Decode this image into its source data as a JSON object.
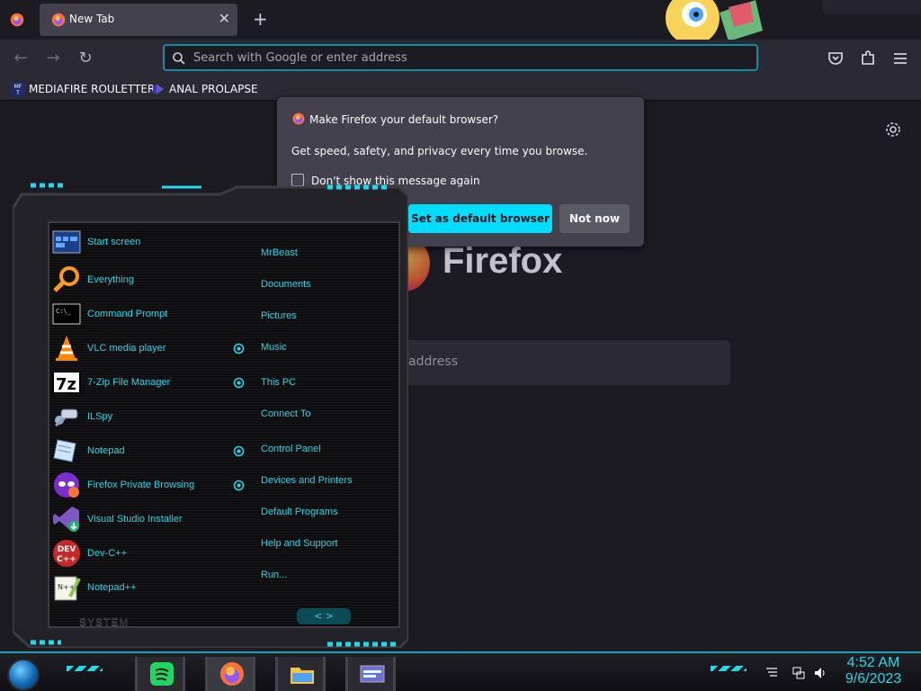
{
  "browser": {
    "tab": {
      "title": "New Tab"
    },
    "urlbar": {
      "placeholder": "Search with Google or enter address"
    },
    "bookmarks": [
      {
        "label": "MEDIAFIRE ROULETTER",
        "icon": "mft-favicon"
      },
      {
        "label": "ANAL PROLAPSE",
        "icon": "bookmark-favicon"
      }
    ],
    "newtab": {
      "wordmark": "Firefox",
      "search_placeholder": "address"
    }
  },
  "popup": {
    "title": "Make Firefox your default browser?",
    "body": "Get speed, safety, and privacy every time you browse.",
    "checkbox_label": "Don't show this message again",
    "primary_label": "Set as default browser",
    "secondary_label": "Not now"
  },
  "startmenu": {
    "pinned": [
      {
        "label": "Start screen",
        "icon": "start-screen-icon"
      },
      {
        "label": "Everything",
        "icon": "magnifier-icon"
      },
      {
        "label": "Command Prompt",
        "icon": "cmd-icon"
      },
      {
        "label": "VLC media player",
        "icon": "vlc-cone-icon"
      },
      {
        "label": "7-Zip File Manager",
        "icon": "7zip-icon"
      },
      {
        "label": "ILSpy",
        "icon": "ilspy-icon"
      },
      {
        "label": "Notepad",
        "icon": "notepad-icon"
      },
      {
        "label": "Firefox Private Browsing",
        "icon": "firefox-private-icon"
      },
      {
        "label": "Visual Studio Installer",
        "icon": "vs-installer-icon"
      },
      {
        "label": "Dev-C++",
        "icon": "devcpp-icon"
      },
      {
        "label": "Notepad++",
        "icon": "notepadpp-icon"
      }
    ],
    "places": [
      "MrBeast",
      "Documents",
      "Pictures",
      "Music",
      "This PC",
      "Connect To",
      "Control Panel",
      "Devices and Printers",
      "Default Programs",
      "Help and Support",
      "Run..."
    ],
    "system_label": "SYSTEM",
    "nav_glyph": "< >"
  },
  "taskbar": {
    "apps": [
      {
        "name": "spotify",
        "icon": "spotify-icon"
      },
      {
        "name": "firefox",
        "icon": "firefox-icon"
      },
      {
        "name": "file-explorer",
        "icon": "folder-icon"
      },
      {
        "name": "window",
        "icon": "window-icon"
      }
    ],
    "clock": {
      "time": "4:52 AM",
      "date": "9/6/2023"
    }
  },
  "colors": {
    "accent_cyan": "#23d7ec",
    "firefox_primary_button": "#00ddff",
    "popup_bg": "#42414d",
    "page_bg": "#1c1b22"
  }
}
